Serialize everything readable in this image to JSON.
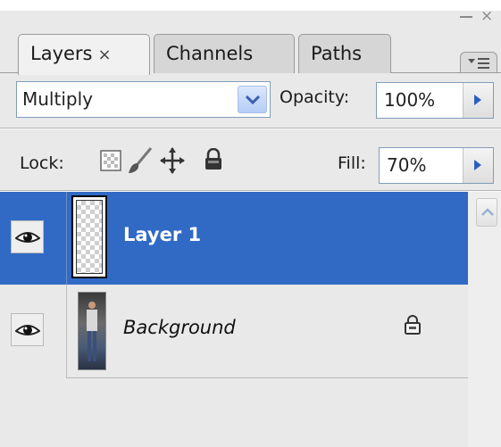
{
  "panel": {
    "tabs": [
      {
        "label": "Layers",
        "close": "×",
        "active": true
      },
      {
        "label": "Channels",
        "active": false
      },
      {
        "label": "Paths",
        "active": false
      }
    ],
    "window_minimize": "–",
    "window_close": "×"
  },
  "blend": {
    "mode": "Multiply",
    "opacity_label": "Opacity:",
    "opacity_value": "100%"
  },
  "lock": {
    "label": "Lock:",
    "fill_label": "Fill:",
    "fill_value": "70%"
  },
  "layers": [
    {
      "name": "Layer 1",
      "selected": true,
      "visible": true,
      "thumbnail": "transparent-checker"
    },
    {
      "name": "Background",
      "selected": false,
      "visible": true,
      "locked": true,
      "thumbnail": "photo-person"
    }
  ],
  "colors": {
    "selection": "#316ac5",
    "panel_bg": "#e9e9e9",
    "field_border": "#7f9db9"
  },
  "icons": [
    "eye-icon",
    "lock-transparent-icon",
    "lock-brush-icon",
    "lock-move-icon",
    "lock-all-icon",
    "panel-menu-icon",
    "dropdown-chevron-icon",
    "arrow-right-icon",
    "scroll-up-icon"
  ]
}
